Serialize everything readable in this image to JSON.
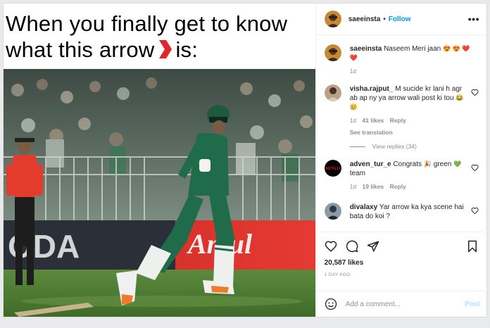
{
  "meme": {
    "line1": "When you finally get to know",
    "line2_before": "what this arrow",
    "line2_after": "is:"
  },
  "header": {
    "username": "saeeinsta",
    "dot": "•",
    "follow_label": "Follow",
    "more_icon": "more-horizontal-icon"
  },
  "caption": {
    "username": "saeeinsta",
    "text": "Naseem Meri jaan",
    "emojis": "😍 😍 ❤️ ❤️",
    "age": "1d"
  },
  "comments": [
    {
      "username": "visha.rajput_",
      "text": "M sucide kr lani h agr ab ap ny ya arrow wali post ki tou",
      "emojis": "😂 😢",
      "age": "1d",
      "likes": "41 likes",
      "reply": "Reply",
      "extra": "See translation",
      "view_replies": "View replies (34)"
    },
    {
      "username": "adven_tur_e",
      "text": "Congrats",
      "emojis_mid": "🎉",
      "text2": "green",
      "emoji_end": "💚",
      "text3": "team",
      "avatar_text": "NETFLIX",
      "age": "1d",
      "likes": "19 likes",
      "reply": "Reply"
    },
    {
      "username": "divalaxy",
      "text": "Yar arrow ka kya scene hai bata do koi ?"
    }
  ],
  "actions": {
    "likes": "20,587 likes",
    "timestamp": "1 DAY AGO"
  },
  "comment_box": {
    "placeholder": "Add a comment...",
    "post_label": "Post"
  },
  "photo": {
    "ad_board_left": "ODA",
    "ad_board_right": "Amul"
  },
  "colors": {
    "accent": "#0095f6",
    "arrow_red": "#e3242b",
    "pitch_green": "#4f7b35",
    "jersey_green": "#1f6b4a"
  }
}
